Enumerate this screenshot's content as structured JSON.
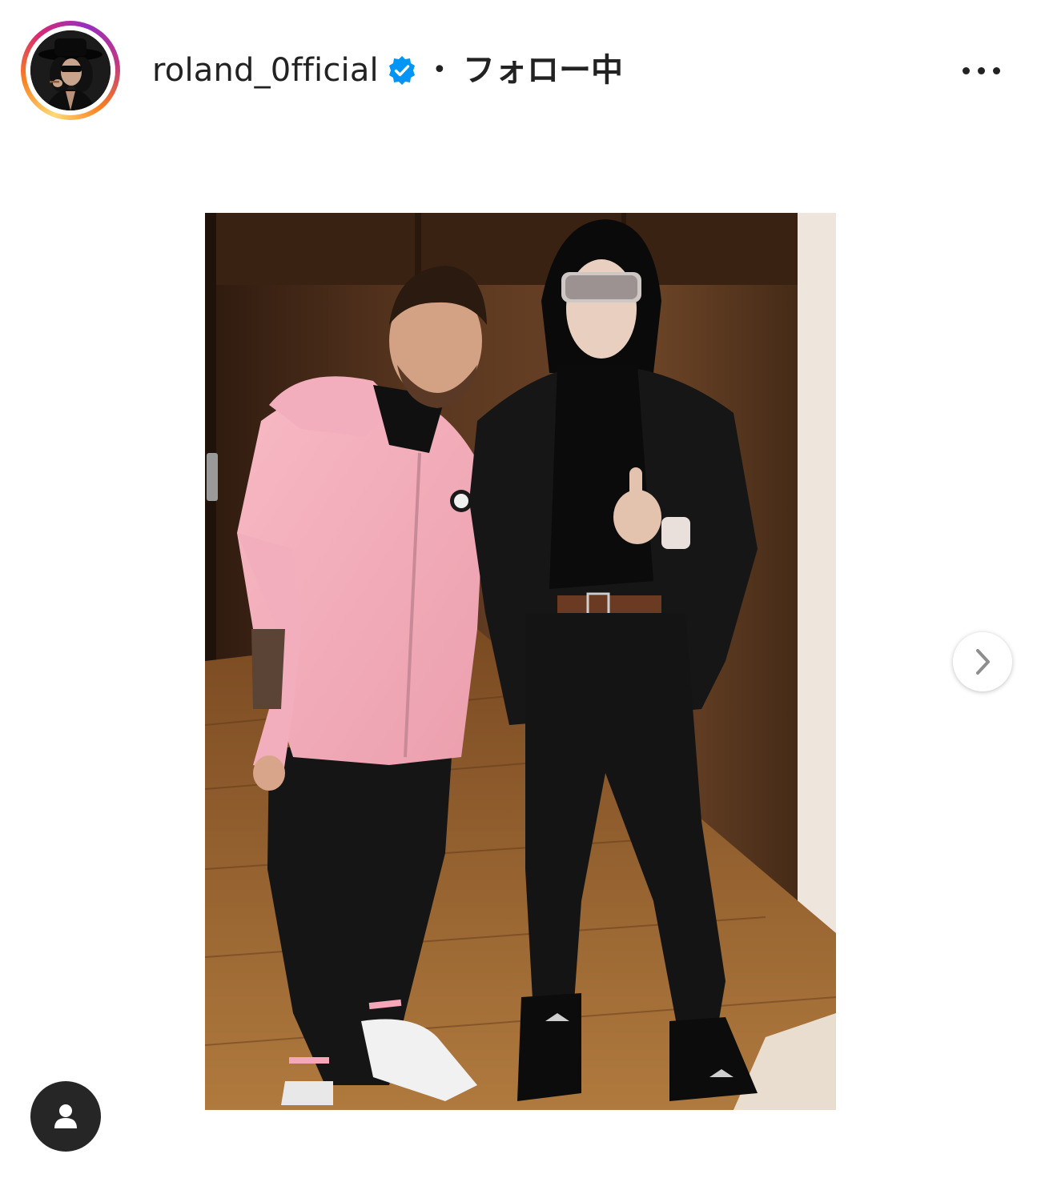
{
  "post": {
    "username": "roland_0fficial",
    "verified": true,
    "separator": "•",
    "follow_status": "フォロー中",
    "more_icon": "more-horizontal-icon",
    "verified_color": "#0095f6",
    "avatar_ring_colors": [
      "#feda75",
      "#fa7e1e",
      "#d62976",
      "#962fbf"
    ]
  },
  "media": {
    "carousel_next_icon": "chevron-right-icon",
    "tags_icon": "user-icon"
  }
}
